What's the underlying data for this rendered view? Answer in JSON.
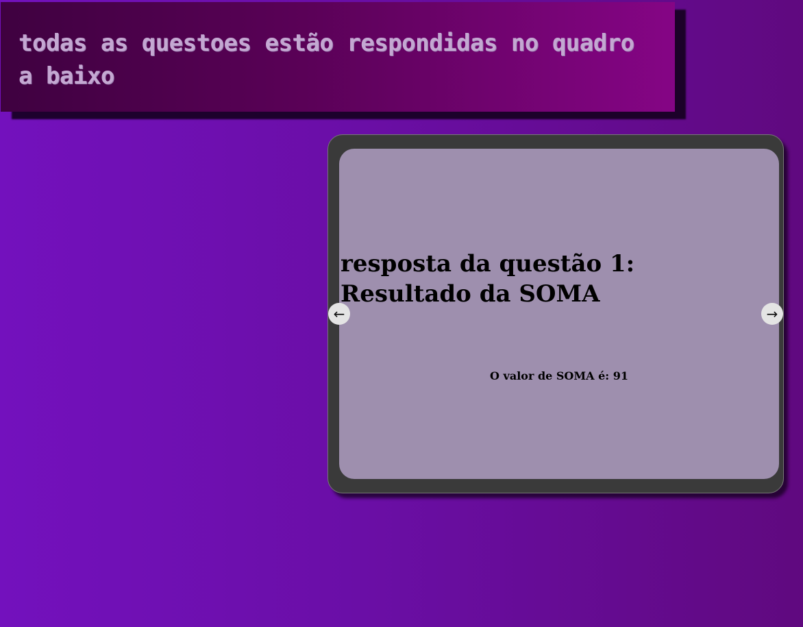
{
  "header": {
    "text": "todas as questoes estão respondidas no quadro a baixo"
  },
  "slider": {
    "slide": {
      "title": "resposta da questão 1: Resultado da SOMA",
      "result": "O valor de SOMA é: 91"
    },
    "prev_label": "←",
    "next_label": "→"
  }
}
